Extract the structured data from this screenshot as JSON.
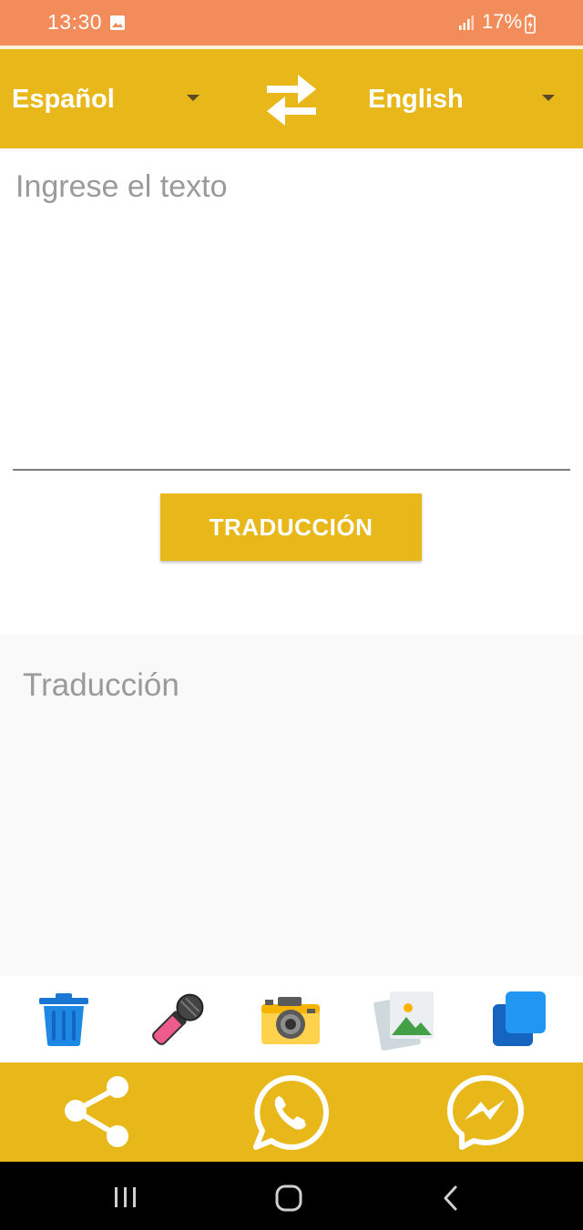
{
  "status_bar": {
    "time": "13:30",
    "battery": "17%",
    "background": "#f28c5a"
  },
  "language_bar": {
    "source_language": "Español",
    "target_language": "English",
    "background": "#e8b81a",
    "swap_icon": "swap-arrows-icon"
  },
  "input": {
    "placeholder": "Ingrese el texto",
    "value": ""
  },
  "translate_button": {
    "label": "TRADUCCIÓN"
  },
  "output": {
    "placeholder": "Traducción"
  },
  "tools": [
    {
      "name": "delete",
      "icon": "trash-icon"
    },
    {
      "name": "voice",
      "icon": "microphone-icon"
    },
    {
      "name": "camera",
      "icon": "camera-icon"
    },
    {
      "name": "gallery",
      "icon": "gallery-icon"
    },
    {
      "name": "copy",
      "icon": "copy-icon"
    }
  ],
  "share_bar": {
    "background": "#e8b81a",
    "buttons": [
      "share-icon",
      "whatsapp-icon",
      "messenger-icon"
    ]
  },
  "nav_bar": {
    "buttons": [
      "recents-icon",
      "home-icon",
      "back-icon"
    ]
  }
}
